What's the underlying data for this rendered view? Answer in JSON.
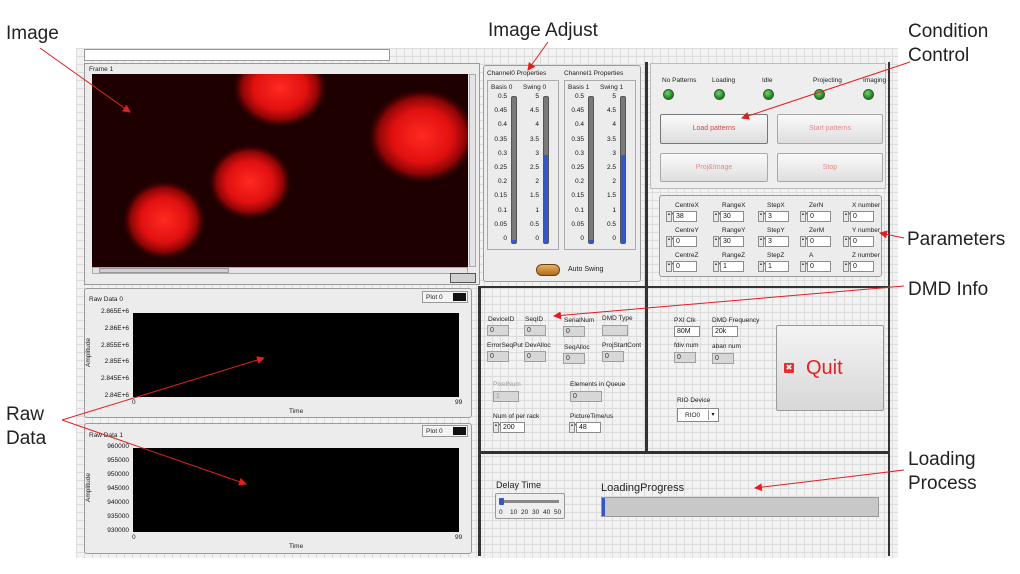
{
  "annotations": {
    "image": "Image",
    "image_adjust": "Image Adjust",
    "condition_control": "Condition\nControl",
    "parameters": "Parameters",
    "dmd_info": "DMD Info",
    "raw_data": "Raw\nData",
    "loading_process": "Loading\nProcess"
  },
  "frame": {
    "title": "Frame 1"
  },
  "channel0": {
    "title": "Channel0 Properties",
    "basis": "Basis 0",
    "swing": "Swing 0"
  },
  "channel1": {
    "title": "Channel1 Properties",
    "basis": "Basis 1",
    "swing": "Swing 1"
  },
  "basis_ticks": [
    "0.5",
    "0.45",
    "0.4",
    "0.35",
    "0.3",
    "0.25",
    "0.2",
    "0.15",
    "0.1",
    "0.05",
    "0"
  ],
  "swing_ticks": [
    "5",
    "4.5",
    "4",
    "3.5",
    "3",
    "2.5",
    "2",
    "1.5",
    "1",
    "0.5",
    "0"
  ],
  "auto_swing": "Auto Swing",
  "status": {
    "leds": [
      "No Patterns",
      "Loading",
      "Idle",
      "Projecting",
      "Imaging"
    ]
  },
  "buttons": {
    "load_patterns": "Load patterns",
    "start_patterns": "Start patterns",
    "proj_image": "Proj&Image",
    "stop": "Stop",
    "quit": "Quit"
  },
  "params": {
    "row1": [
      {
        "label": "CentreX",
        "value": "38"
      },
      {
        "label": "RangeX",
        "value": "30"
      },
      {
        "label": "StepX",
        "value": "3"
      },
      {
        "label": "ZerN",
        "value": "0"
      },
      {
        "label": "X number",
        "value": "0"
      }
    ],
    "row2": [
      {
        "label": "CentreY",
        "value": "0"
      },
      {
        "label": "RangeY",
        "value": "30"
      },
      {
        "label": "StepY",
        "value": "3"
      },
      {
        "label": "ZerM",
        "value": "0"
      },
      {
        "label": "Y number",
        "value": "0"
      }
    ],
    "row3": [
      {
        "label": "CentreZ",
        "value": "0"
      },
      {
        "label": "RangeZ",
        "value": "1"
      },
      {
        "label": "StepZ",
        "value": "1"
      },
      {
        "label": "A",
        "value": "0"
      },
      {
        "label": "Z number",
        "value": "0"
      }
    ]
  },
  "dmd": {
    "device_id": "DeviceID",
    "device_id_val": "0",
    "seq_id": "SeqID",
    "seq_id_val": "0",
    "serial_num": "SerialNum",
    "serial_num_val": "0",
    "dmd_type": "DMD Type",
    "error_seq_put": "ErrorSeqPut",
    "error_seq_put_val": "0",
    "dev_alloc": "DevAlloc",
    "dev_alloc_val": "0",
    "seq_alloc": "SeqAlloc",
    "seq_alloc_val": "0",
    "proj_start_cont": "ProjStartCont",
    "proj_start_cont_val": "0",
    "pixel_num": "PixelNum",
    "pixel_num_val": "1",
    "elements_in_queue": "Elements in Queue",
    "elements_in_queue_val": "0",
    "num_per_rack": "Num of per rack",
    "num_per_rack_val": "200",
    "picture_time": "PictureTime/us",
    "picture_time_val": "48"
  },
  "pxi": {
    "pxi_clk": "PXI Clk",
    "pxi_clk_val": "80M",
    "dmd_freq": "DMD Frequency",
    "dmd_freq_val": "20k",
    "fdiv_num": "fdiv num",
    "fdiv_num_val": "0",
    "aban_num": "aban num",
    "aban_num_val": "0",
    "rio_device": "RIO Device",
    "rio_device_val": "RIO0"
  },
  "raw0": {
    "title": "Raw Data 0",
    "plot_label": "Plot 0",
    "yticks": [
      "2.865E+6",
      "2.86E+6",
      "2.855E+6",
      "2.85E+6",
      "2.845E+6",
      "2.84E+6"
    ],
    "xmin": "0",
    "xmax": "99",
    "xlabel": "Time",
    "ylabel": "Amplitude"
  },
  "raw1": {
    "title": "Raw Data 1",
    "plot_label": "Plot 0",
    "yticks": [
      "960000",
      "955000",
      "950000",
      "945000",
      "940000",
      "935000",
      "930000"
    ],
    "xmin": "0",
    "xmax": "99",
    "xlabel": "Time",
    "ylabel": "Amplitude"
  },
  "delay": {
    "title": "Delay Time",
    "ticks": [
      "0",
      "10",
      "20",
      "30",
      "40",
      "50"
    ],
    "value": 0
  },
  "loading": {
    "title": "LoadingProgress",
    "progress": 0.01
  }
}
